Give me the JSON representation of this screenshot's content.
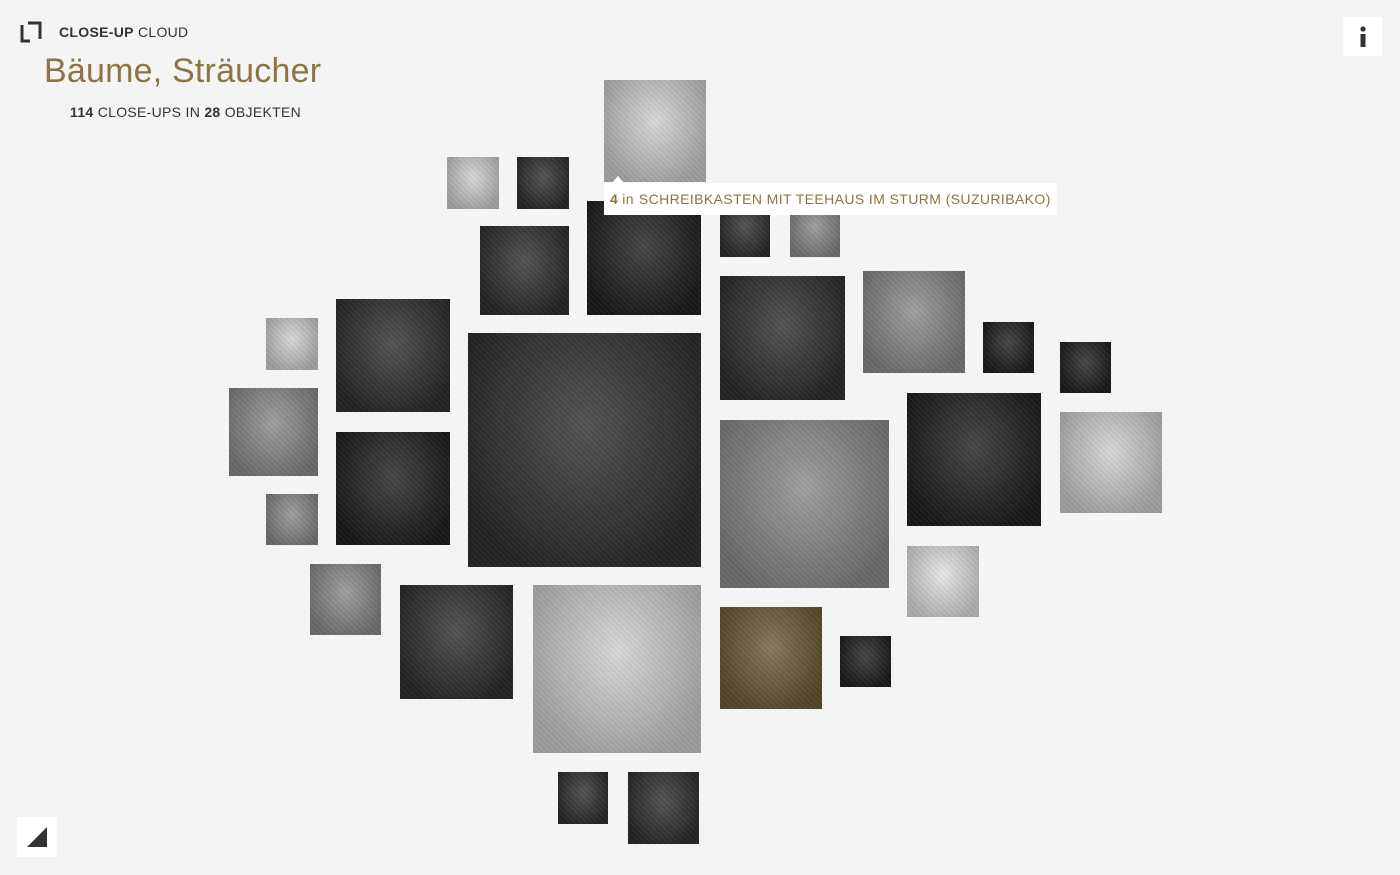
{
  "app": {
    "title_bold": "CLOSE-UP",
    "title_rest": "CLOUD"
  },
  "page": {
    "title": "Bäume, Sträucher"
  },
  "stats": {
    "closeups_count": "114",
    "closeups_label": "CLOSE-UPS IN",
    "objects_count": "28",
    "objects_label": "OBJEKTEN"
  },
  "tooltip": {
    "count": "4",
    "in": "in",
    "object_name": "SCHREIBKASTEN MIT TEEHAUS IM STURM (SUZURIBAKO)"
  },
  "icons": {
    "logo": "logo-icon",
    "info": "info-icon",
    "corner": "corner-triangle-icon"
  },
  "colors": {
    "accent": "#8c7443",
    "background": "#f4f4f4"
  }
}
